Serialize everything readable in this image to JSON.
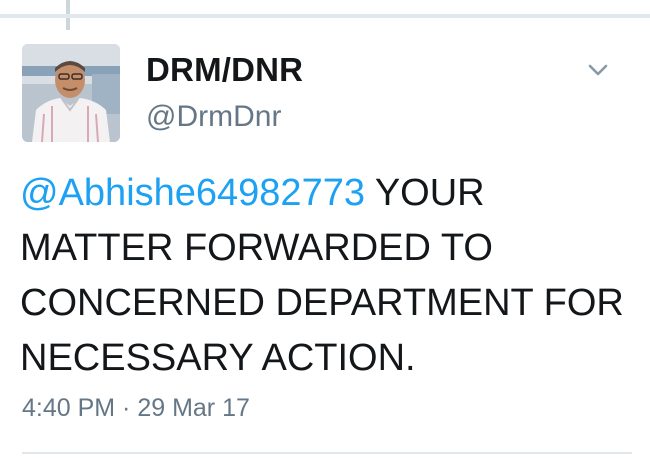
{
  "tweet": {
    "author": {
      "display_name": "DRM/DNR",
      "handle": "@DrmDnr"
    },
    "text": {
      "mention": "@Abhishe64982773",
      "body": " YOUR MATTER FORWARDED TO CONCERNED DEPARTMENT FOR NECESSARY ACTION."
    },
    "timestamp": "4:40 PM · 29 Mar 17"
  },
  "icons": {
    "menu": "chevron-down-icon"
  },
  "colors": {
    "link": "#1da1f2",
    "secondary_text": "#657786",
    "primary_text": "#14171a",
    "divider": "#e1e8ed"
  }
}
